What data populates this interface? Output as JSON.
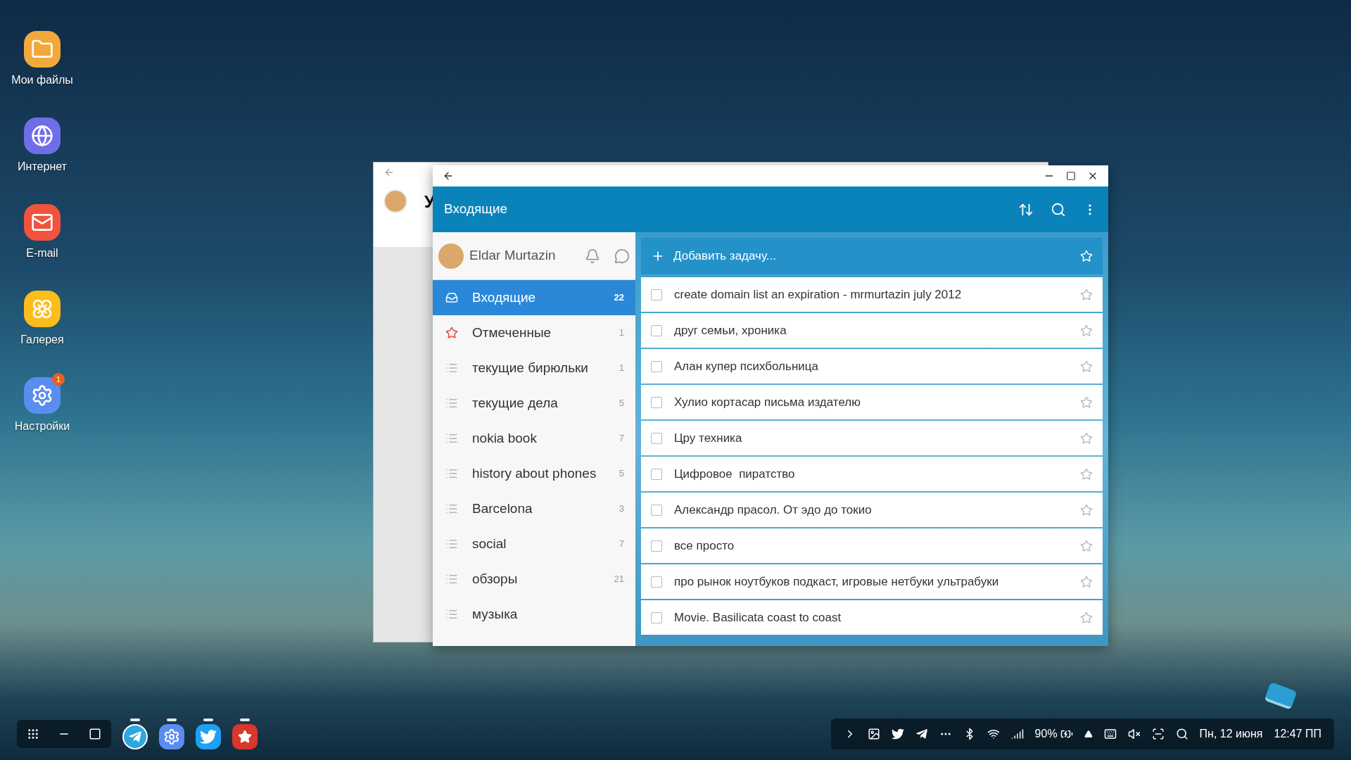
{
  "desktop_icons": [
    {
      "kind": "files",
      "label": "Мои файлы"
    },
    {
      "kind": "internet",
      "label": "Интернет"
    },
    {
      "kind": "email",
      "label": "E-mail"
    },
    {
      "kind": "gallery",
      "label": "Галерея"
    },
    {
      "kind": "settings",
      "label": "Настройки",
      "badge": "1"
    }
  ],
  "back_window": {
    "title_letter": "У"
  },
  "window": {
    "title": "Входящие",
    "user": {
      "name": "Eldar Murtazin"
    },
    "sidebar": {
      "items": [
        {
          "kind": "inbox",
          "label": "Входящие",
          "count": "22",
          "selected": true
        },
        {
          "kind": "starred",
          "label": "Отмеченные",
          "count": "1",
          "selected": false
        },
        {
          "kind": "list",
          "label": "текущие бирюльки",
          "count": "1",
          "selected": false
        },
        {
          "kind": "list",
          "label": "текущие дела",
          "count": "5",
          "selected": false
        },
        {
          "kind": "list",
          "label": "nokia book",
          "count": "7",
          "selected": false
        },
        {
          "kind": "list",
          "label": "history about phones",
          "count": "5",
          "selected": false
        },
        {
          "kind": "list",
          "label": "Barcelona",
          "count": "3",
          "selected": false
        },
        {
          "kind": "list",
          "label": "social",
          "count": "7",
          "selected": false
        },
        {
          "kind": "list",
          "label": "обзоры",
          "count": "21",
          "selected": false
        },
        {
          "kind": "list",
          "label": "музыка",
          "selected": false
        }
      ]
    },
    "add_task": {
      "placeholder": "Добавить задачу..."
    },
    "tasks": [
      {
        "text": "create domain list an expiration - mrmurtazin july 2012",
        "checked": false,
        "starred": false
      },
      {
        "text": "друг семьи, хроника",
        "checked": false,
        "starred": false
      },
      {
        "text": "Алан купер психбольница",
        "checked": false,
        "starred": false
      },
      {
        "text": "Хулио кортасар письма издателю",
        "checked": false,
        "starred": false
      },
      {
        "text": "Цру техника",
        "checked": false,
        "starred": false
      },
      {
        "text": "Цифровое  пиратство",
        "checked": false,
        "starred": false
      },
      {
        "text": "Александр прасол. От эдо до токио",
        "checked": false,
        "starred": false
      },
      {
        "text": "все просто",
        "checked": false,
        "starred": false
      },
      {
        "text": "про рынок ноутбуков подкаст, игровые нетбуки ультрабуки",
        "checked": false,
        "starred": false
      },
      {
        "text": "Movie. Basilicata coast to coast",
        "checked": false,
        "starred": false
      }
    ]
  },
  "taskbar": {
    "apps": [
      {
        "kind": "telegram"
      },
      {
        "kind": "settings"
      },
      {
        "kind": "twitter"
      },
      {
        "kind": "wunderlist"
      }
    ],
    "status": {
      "battery": "90%",
      "date": "Пн, 12 июня",
      "time": "12:47 ПП"
    }
  }
}
